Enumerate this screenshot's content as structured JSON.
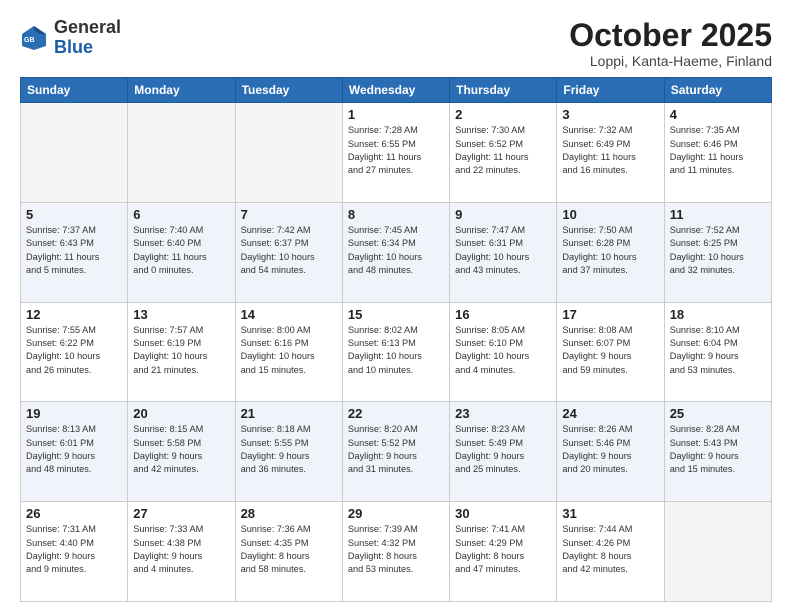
{
  "header": {
    "logo_general": "General",
    "logo_blue": "Blue",
    "month_title": "October 2025",
    "location": "Loppi, Kanta-Haeme, Finland"
  },
  "weekdays": [
    "Sunday",
    "Monday",
    "Tuesday",
    "Wednesday",
    "Thursday",
    "Friday",
    "Saturday"
  ],
  "weeks": [
    [
      {
        "day": "",
        "info": ""
      },
      {
        "day": "",
        "info": ""
      },
      {
        "day": "",
        "info": ""
      },
      {
        "day": "1",
        "info": "Sunrise: 7:28 AM\nSunset: 6:55 PM\nDaylight: 11 hours\nand 27 minutes."
      },
      {
        "day": "2",
        "info": "Sunrise: 7:30 AM\nSunset: 6:52 PM\nDaylight: 11 hours\nand 22 minutes."
      },
      {
        "day": "3",
        "info": "Sunrise: 7:32 AM\nSunset: 6:49 PM\nDaylight: 11 hours\nand 16 minutes."
      },
      {
        "day": "4",
        "info": "Sunrise: 7:35 AM\nSunset: 6:46 PM\nDaylight: 11 hours\nand 11 minutes."
      }
    ],
    [
      {
        "day": "5",
        "info": "Sunrise: 7:37 AM\nSunset: 6:43 PM\nDaylight: 11 hours\nand 5 minutes."
      },
      {
        "day": "6",
        "info": "Sunrise: 7:40 AM\nSunset: 6:40 PM\nDaylight: 11 hours\nand 0 minutes."
      },
      {
        "day": "7",
        "info": "Sunrise: 7:42 AM\nSunset: 6:37 PM\nDaylight: 10 hours\nand 54 minutes."
      },
      {
        "day": "8",
        "info": "Sunrise: 7:45 AM\nSunset: 6:34 PM\nDaylight: 10 hours\nand 48 minutes."
      },
      {
        "day": "9",
        "info": "Sunrise: 7:47 AM\nSunset: 6:31 PM\nDaylight: 10 hours\nand 43 minutes."
      },
      {
        "day": "10",
        "info": "Sunrise: 7:50 AM\nSunset: 6:28 PM\nDaylight: 10 hours\nand 37 minutes."
      },
      {
        "day": "11",
        "info": "Sunrise: 7:52 AM\nSunset: 6:25 PM\nDaylight: 10 hours\nand 32 minutes."
      }
    ],
    [
      {
        "day": "12",
        "info": "Sunrise: 7:55 AM\nSunset: 6:22 PM\nDaylight: 10 hours\nand 26 minutes."
      },
      {
        "day": "13",
        "info": "Sunrise: 7:57 AM\nSunset: 6:19 PM\nDaylight: 10 hours\nand 21 minutes."
      },
      {
        "day": "14",
        "info": "Sunrise: 8:00 AM\nSunset: 6:16 PM\nDaylight: 10 hours\nand 15 minutes."
      },
      {
        "day": "15",
        "info": "Sunrise: 8:02 AM\nSunset: 6:13 PM\nDaylight: 10 hours\nand 10 minutes."
      },
      {
        "day": "16",
        "info": "Sunrise: 8:05 AM\nSunset: 6:10 PM\nDaylight: 10 hours\nand 4 minutes."
      },
      {
        "day": "17",
        "info": "Sunrise: 8:08 AM\nSunset: 6:07 PM\nDaylight: 9 hours\nand 59 minutes."
      },
      {
        "day": "18",
        "info": "Sunrise: 8:10 AM\nSunset: 6:04 PM\nDaylight: 9 hours\nand 53 minutes."
      }
    ],
    [
      {
        "day": "19",
        "info": "Sunrise: 8:13 AM\nSunset: 6:01 PM\nDaylight: 9 hours\nand 48 minutes."
      },
      {
        "day": "20",
        "info": "Sunrise: 8:15 AM\nSunset: 5:58 PM\nDaylight: 9 hours\nand 42 minutes."
      },
      {
        "day": "21",
        "info": "Sunrise: 8:18 AM\nSunset: 5:55 PM\nDaylight: 9 hours\nand 36 minutes."
      },
      {
        "day": "22",
        "info": "Sunrise: 8:20 AM\nSunset: 5:52 PM\nDaylight: 9 hours\nand 31 minutes."
      },
      {
        "day": "23",
        "info": "Sunrise: 8:23 AM\nSunset: 5:49 PM\nDaylight: 9 hours\nand 25 minutes."
      },
      {
        "day": "24",
        "info": "Sunrise: 8:26 AM\nSunset: 5:46 PM\nDaylight: 9 hours\nand 20 minutes."
      },
      {
        "day": "25",
        "info": "Sunrise: 8:28 AM\nSunset: 5:43 PM\nDaylight: 9 hours\nand 15 minutes."
      }
    ],
    [
      {
        "day": "26",
        "info": "Sunrise: 7:31 AM\nSunset: 4:40 PM\nDaylight: 9 hours\nand 9 minutes."
      },
      {
        "day": "27",
        "info": "Sunrise: 7:33 AM\nSunset: 4:38 PM\nDaylight: 9 hours\nand 4 minutes."
      },
      {
        "day": "28",
        "info": "Sunrise: 7:36 AM\nSunset: 4:35 PM\nDaylight: 8 hours\nand 58 minutes."
      },
      {
        "day": "29",
        "info": "Sunrise: 7:39 AM\nSunset: 4:32 PM\nDaylight: 8 hours\nand 53 minutes."
      },
      {
        "day": "30",
        "info": "Sunrise: 7:41 AM\nSunset: 4:29 PM\nDaylight: 8 hours\nand 47 minutes."
      },
      {
        "day": "31",
        "info": "Sunrise: 7:44 AM\nSunset: 4:26 PM\nDaylight: 8 hours\nand 42 minutes."
      },
      {
        "day": "",
        "info": ""
      }
    ]
  ]
}
